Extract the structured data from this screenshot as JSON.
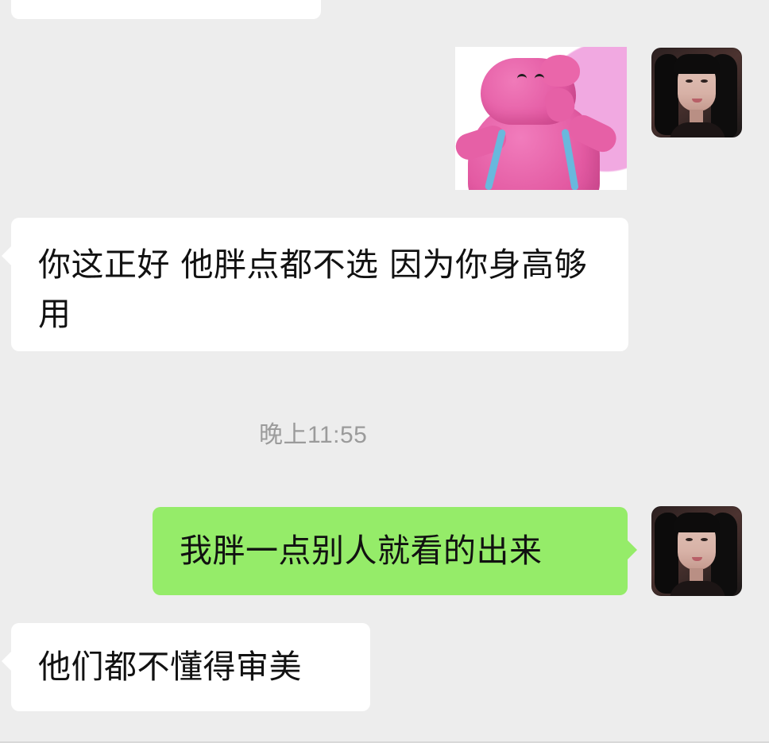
{
  "chat": {
    "messages": [
      {
        "sender": "other",
        "type": "text",
        "text": "你这正好 他胖点都不选  因为你身高够用"
      },
      {
        "sender": "self",
        "type": "text",
        "text": "我胖一点别人就看的出来"
      },
      {
        "sender": "other",
        "type": "text",
        "text": "他们都不懂得审美"
      }
    ],
    "timestamp": "晚上11:55"
  },
  "colors": {
    "background": "#ededed",
    "incoming_bubble": "#ffffff",
    "outgoing_bubble": "#95ec69",
    "timestamp_text": "#9b9b9b"
  },
  "icons": {
    "sticker": "pink-elephant-sticker",
    "avatar": "user-avatar"
  }
}
